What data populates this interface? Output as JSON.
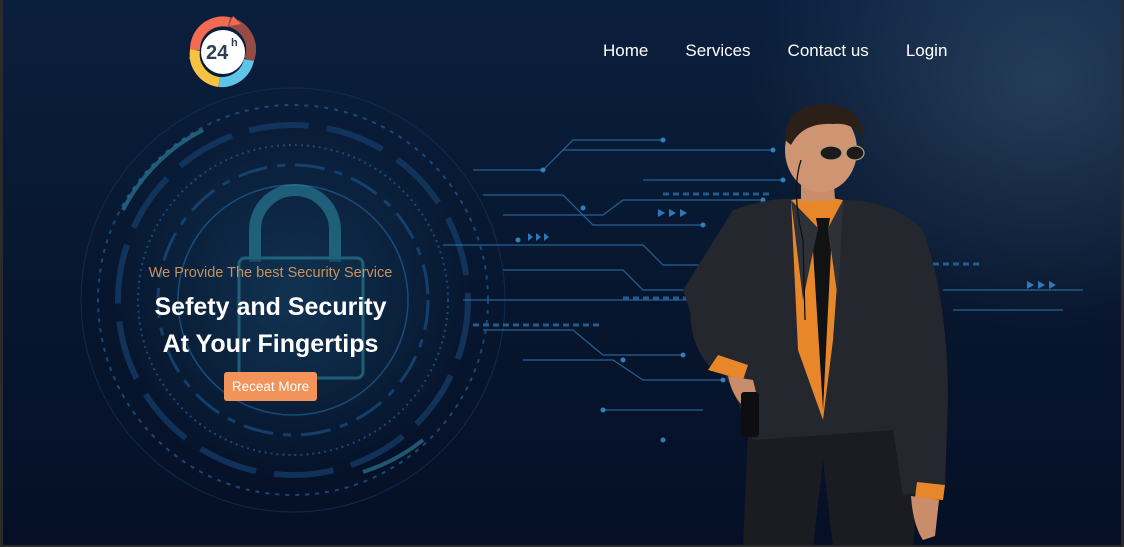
{
  "logo": {
    "text": "24",
    "superscript": "h",
    "colors": [
      "#f26a4f",
      "#5ec4e8",
      "#f7c341"
    ]
  },
  "nav": {
    "items": [
      "Home",
      "Services",
      "Contact us",
      "Login"
    ]
  },
  "hero": {
    "tagline": "We Provide The best Security Service",
    "headline_line1": "Sefety and Security",
    "headline_line2": "At Your Fingertips",
    "cta_label": "Receat More"
  },
  "colors": {
    "accent": "#f2935a",
    "tagline": "#c9915f",
    "background": "#0a1f3d",
    "circuit": "#2f7bb8"
  }
}
